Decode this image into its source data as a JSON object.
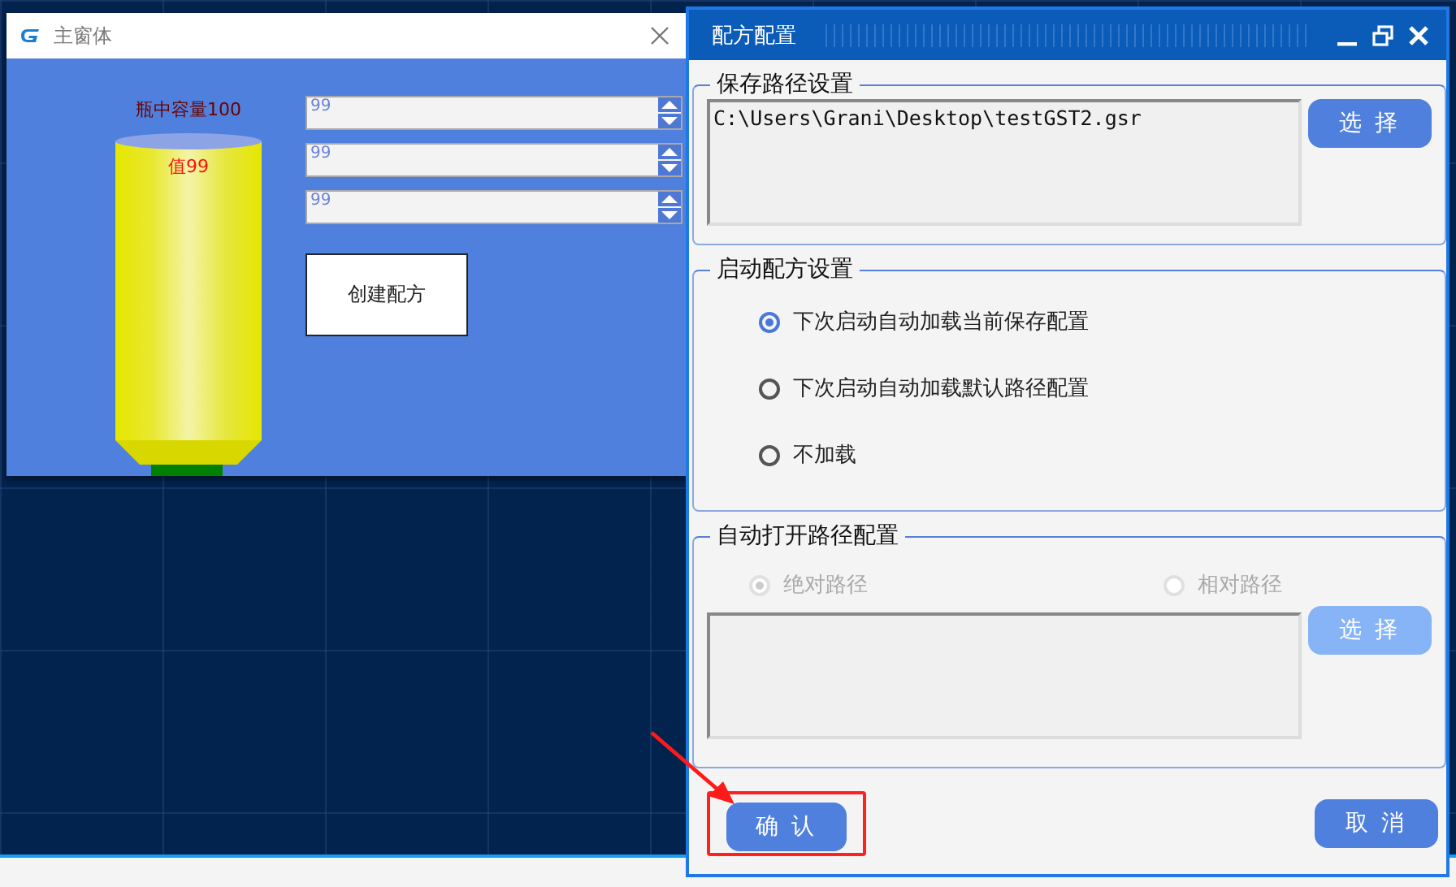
{
  "main_window": {
    "title": "主窗体",
    "tank": {
      "capacity_label": "瓶中容量100",
      "value_label": "值99"
    },
    "spinboxes": [
      {
        "value": "99"
      },
      {
        "value": "99"
      },
      {
        "value": "99"
      }
    ],
    "create_button": "创建配方"
  },
  "dialog": {
    "title": "配方配置",
    "save_path": {
      "legend": "保存路径设置",
      "path": "C:\\Users\\Grani\\Desktop\\testGST2.gsr",
      "button": "选 择"
    },
    "startup": {
      "legend": "启动配方设置",
      "options": [
        {
          "label": "下次启动自动加载当前保存配置",
          "selected": true
        },
        {
          "label": "下次启动自动加载默认路径配置",
          "selected": false
        },
        {
          "label": "不加载",
          "selected": false
        }
      ]
    },
    "auto_open": {
      "legend": "自动打开路径配置",
      "disabled": true,
      "options": [
        {
          "label": "绝对路径",
          "selected": true
        },
        {
          "label": "相对路径",
          "selected": false
        }
      ],
      "button": "选 择"
    },
    "confirm_button": "确 认",
    "cancel_button": "取 消"
  }
}
